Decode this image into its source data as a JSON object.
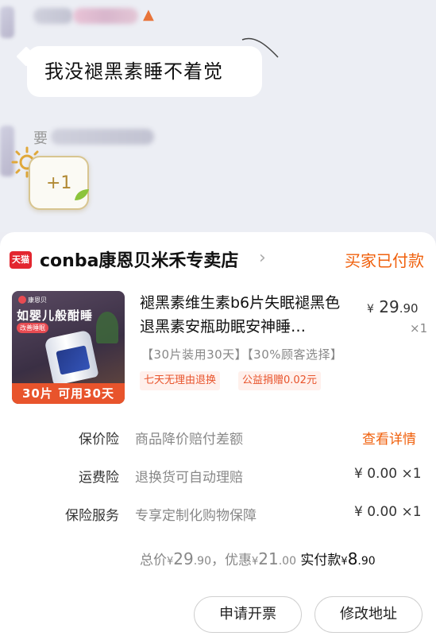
{
  "chat": {
    "message": "我没褪黑素睡不着觉",
    "second_sender_prefix": "要",
    "sticker_text": "+1"
  },
  "order": {
    "platform_badge": "天猫",
    "shop_name": "conba康恩贝米禾专卖店",
    "status": "买家已付款",
    "product": {
      "image_brand": "康恩贝",
      "image_title": "如婴儿般酣睡",
      "image_tag": "改善睡眠",
      "image_banner": "30片 可用30天",
      "title": "褪黑素维生素b6片失眠褪黑色退黑素安瓶助眠安神睡…",
      "price_symbol": "¥",
      "price_int": "29",
      "price_dec": ".90",
      "qty": "×1",
      "sku": "【30片装用30天】【30%顾客选择】",
      "tags": [
        "七天无理由退换",
        "公益捐赠0.02元"
      ]
    },
    "services": [
      {
        "label": "保价险",
        "desc": "商品降价赔付差额",
        "action": "查看详情"
      },
      {
        "label": "运费险",
        "desc": "退换货可自动理赔",
        "amount": "¥ 0.00 ×1"
      },
      {
        "label": "保险服务",
        "desc": "专享定制化购物保障",
        "amount": "¥ 0.00 ×1"
      }
    ],
    "summary": {
      "total_label": "总价",
      "total_int": "29",
      "total_dec": ".90",
      "discount_label": "，优惠",
      "discount_int": "21",
      "discount_dec": ".00",
      "paid_label": "实付款",
      "paid_int": "8",
      "paid_dec": ".90",
      "yen": "¥"
    },
    "buttons": {
      "invoice": "申请开票",
      "change_address": "修改地址"
    }
  },
  "colors": {
    "accent": "#f0600c",
    "tag_text": "#e8542c",
    "tmall_red": "#e3262f"
  }
}
